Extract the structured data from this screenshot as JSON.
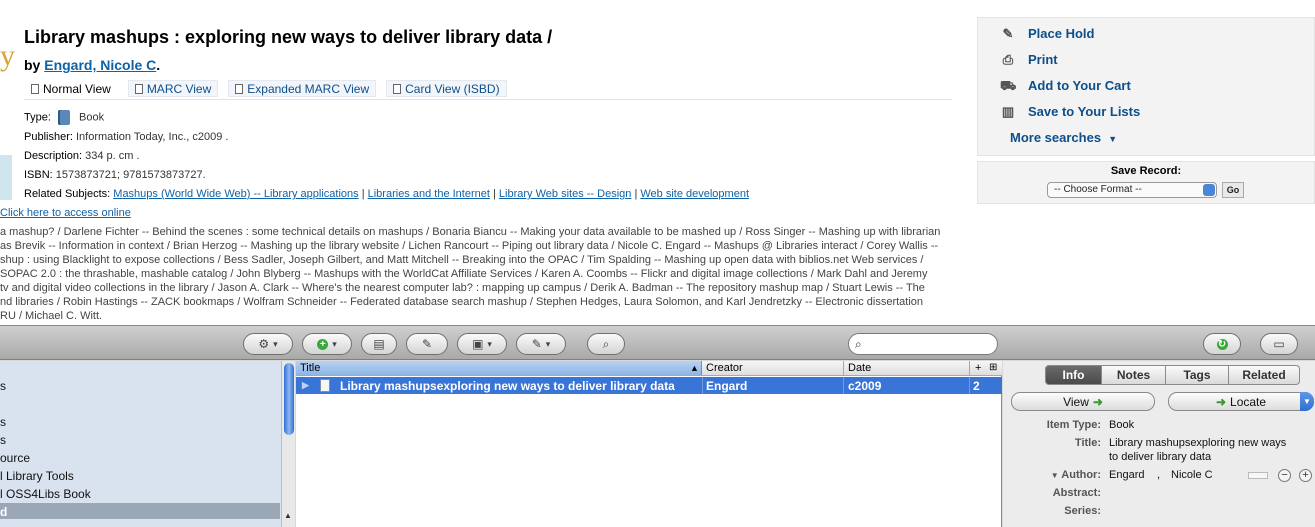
{
  "record": {
    "title": "Library mashups : exploring new ways to deliver library data /",
    "by_prefix": "by",
    "author": "Engard, Nicole C",
    "author_suffix": "."
  },
  "views": [
    {
      "label": "Normal View"
    },
    {
      "label": "MARC View"
    },
    {
      "label": "Expanded MARC View"
    },
    {
      "label": "Card View (ISBD)"
    }
  ],
  "meta": {
    "type_label": "Type:",
    "type_value": "Book",
    "publisher_label": "Publisher:",
    "publisher_value": "Information Today, Inc., c2009 .",
    "description_label": "Description:",
    "description_value": "334 p. cm .",
    "isbn_label": "ISBN:",
    "isbn_value": "1573873721; 9781573873727.",
    "subjects_label": "Related Subjects:",
    "subjects": [
      "Mashups (World Wide Web) -- Library applications",
      "Libraries and the Internet",
      "Library Web sites -- Design",
      "Web site development"
    ],
    "subject_sep": "|"
  },
  "online_link": "Click here to access online",
  "contents_lines": [
    "a mashup? / Darlene Fichter -- Behind the scenes : some technical details on mashups / Bonaria Biancu -- Making your data available to be mashed up / Ross Singer -- Mashing up with librarian",
    "as Brevik -- Information in context / Brian Herzog -- Mashing up the library website / Lichen Rancourt -- Piping out library data / Nicole C. Engard -- Mashups @ Libraries interact / Corey Wallis --",
    "shup : using Blacklight to expose collections / Bess Sadler, Joseph Gilbert, and Matt Mitchell -- Breaking into the OPAC / Tim Spalding -- Mashing up open data with biblios.net Web services /",
    "SOPAC 2.0 : the thrashable, mashable catalog / John Blyberg -- Mashups with the WorldCat Affiliate Services / Karen A. Coombs -- Flickr and digital image collections / Mark Dahl and Jeremy",
    "tv and digital video collections in the library / Jason A. Clark -- Where's the nearest computer lab? : mapping up campus / Derik A. Badman -- The repository mashup map / Stuart Lewis -- The",
    "nd libraries / Robin Hastings -- ZACK bookmaps / Wolfram Schneider -- Federated database search mashup / Stephen Hedges, Laura Solomon, and Karl Jendretzky -- Electronic dissertation",
    "RU / Michael C. Witt."
  ],
  "actions": {
    "place_hold": "Place Hold",
    "print": "Print",
    "add_cart": "Add to Your Cart",
    "save_lists": "Save to Your Lists",
    "more_searches": "More searches",
    "more_arrow": "▼"
  },
  "save_record": {
    "title": "Save Record:",
    "selected": "-- Choose Format --",
    "go": "Go"
  },
  "zotero": {
    "tree_items": [
      "s",
      "s",
      "s",
      "ource",
      "l Library Tools",
      "l OSS4Libs Book",
      "d"
    ],
    "columns": {
      "title": "Title",
      "creator": "Creator",
      "date": "Date",
      "plus": "+"
    },
    "item": {
      "title": "Library mashupsexploring new ways to deliver library data",
      "creator": "Engard",
      "date": "c2009",
      "count": "2"
    },
    "tabs": [
      "Info",
      "Notes",
      "Tags",
      "Related"
    ],
    "view_btn": "View",
    "locate_btn": "Locate",
    "fields": {
      "item_type_label": "Item Type:",
      "item_type": "Book",
      "title_label": "Title:",
      "title_line1": "Library mashupsexploring new ways",
      "title_line2": "to deliver library data",
      "author_label": "Author:",
      "author_last": "Engard",
      "author_comma": ",",
      "author_first": "Nicole C",
      "abstract_label": "Abstract:",
      "series_label": "Series:"
    }
  }
}
